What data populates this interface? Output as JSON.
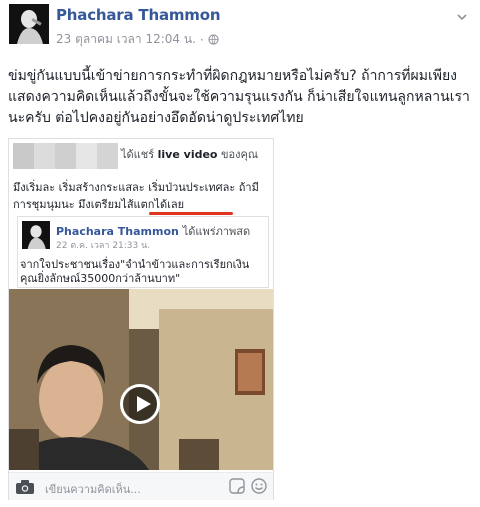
{
  "post": {
    "author": "Phachara Thammon",
    "date": "23 ตุลาคม เวลา 12:04 น.",
    "separator": "·",
    "text": "ข่มขู่กันแบบนี้เข้าข่ายการกระทำที่ผิดกฎหมายหรือไม่ครับ? ถ้าการที่ผมเพียงแสดงความคิดเห็นแล้วถึงขั้นจะใช้ความรุนแรงกัน ก็น่าเสียใจแทนลูกหลานเรานะครับ ต่อไปคงอยู่กันอย่างอึดอัดน่าดูประเทศไทย"
  },
  "shared": {
    "header_prefix": "ได้แชร์",
    "header_bold": "live video",
    "header_suffix": "ของคุณ",
    "text": "มึงเริ่มละ เริ่มสร้างกระแสละ เริ่มป่วนประเทศละ ถ้ามีการชุมนุมนะ มึงเตรียมไส้แตกได้เลย",
    "inner": {
      "author": "Phachara Thammon",
      "action": "ได้แพร่ภาพสด",
      "date": "22 ต.ค. เวลา 21:33 น.",
      "text": "จากใจประชาชนเรื่อง\"จำนำข้าวและการเรียกเงินคุณยิ่งลักษณ์35000กว่าล้านบาท\""
    },
    "comment_placeholder": "เขียนความคิดเห็น..."
  },
  "icons": [
    "avatar",
    "globe-icon",
    "chevron-down-icon",
    "play-icon",
    "camera-icon",
    "sticker-icon",
    "emoji-icon"
  ],
  "colors": {
    "link": "#365899",
    "text": "#1d2129",
    "meta": "#90949c",
    "underline": "#e0341c"
  }
}
